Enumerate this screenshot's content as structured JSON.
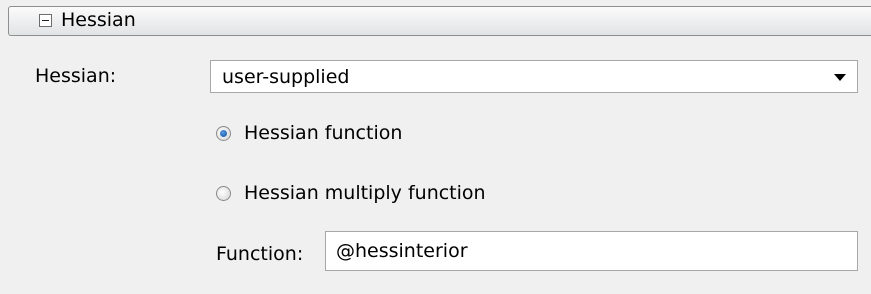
{
  "section": {
    "title": "Hessian"
  },
  "hessian": {
    "label": "Hessian:",
    "selected": "user-supplied",
    "options": [
      {
        "label": "Hessian function",
        "checked": true
      },
      {
        "label": "Hessian multiply function",
        "checked": false
      }
    ]
  },
  "function": {
    "label": "Function:",
    "value": "@hessinterior"
  }
}
